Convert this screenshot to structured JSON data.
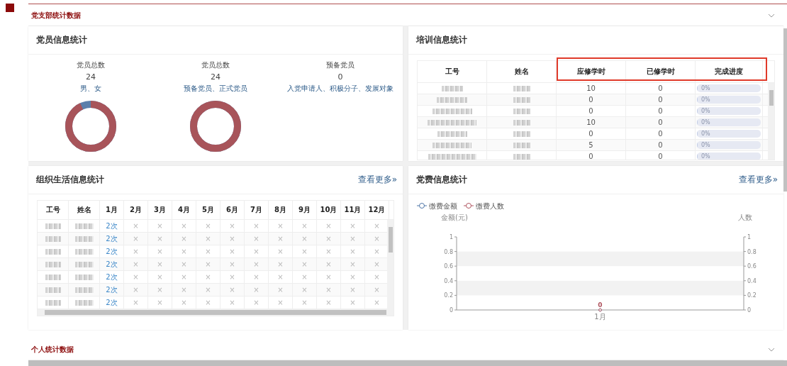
{
  "sections": [
    {
      "title": "党支部统计数据",
      "expanded": true
    },
    {
      "title": "个人统计数据",
      "expanded": false
    }
  ],
  "member_card": {
    "title": "党员信息统计",
    "stats": [
      {
        "label": "党员总数",
        "value": "24",
        "breakdown": "男、女",
        "donut": {
          "level": 0.93
        }
      },
      {
        "label": "党员总数",
        "value": "24",
        "breakdown": "预备党员、正式党员",
        "donut": {
          "level": 1
        }
      },
      {
        "label": "预备党员",
        "value": "0",
        "breakdown": "入党申请人、积极分子、发展对象"
      }
    ]
  },
  "training_card": {
    "title": "培训信息统计",
    "columns": [
      {
        "label": "工号",
        "highlighted": false
      },
      {
        "label": "姓名",
        "highlighted": false
      },
      {
        "label": "应修学时",
        "highlighted": true
      },
      {
        "label": "已修学时",
        "highlighted": true
      },
      {
        "label": "完成进度",
        "highlighted": true
      }
    ],
    "rows": [
      {
        "required": "10",
        "completed": "0",
        "progress": "0%",
        "level": 0
      },
      {
        "required": "0",
        "completed": "0",
        "progress": "0%",
        "level": 0
      },
      {
        "required": "0",
        "completed": "0",
        "progress": "0%",
        "level": 0
      },
      {
        "required": "10",
        "completed": "0",
        "progress": "0%",
        "level": 0
      },
      {
        "required": "0",
        "completed": "0",
        "progress": "0%",
        "level": 0
      },
      {
        "required": "5",
        "completed": "0",
        "progress": "0%",
        "level": 0
      },
      {
        "required": "0",
        "completed": "0",
        "progress": "0%",
        "level": 0
      }
    ]
  },
  "life_card": {
    "title": "组织生活信息统计",
    "more_link": "查看更多»",
    "columns": [
      "工号",
      "姓名",
      "1月",
      "2月",
      "3月",
      "4月",
      "5月",
      "6月",
      "7月",
      "8月",
      "9月",
      "10月",
      "11月",
      "12月"
    ],
    "rows": [
      {
        "months": [
          "2次",
          "×",
          "×",
          "×",
          "×",
          "×",
          "×",
          "×",
          "×",
          "×",
          "×",
          "×"
        ]
      },
      {
        "months": [
          "2次",
          "×",
          "×",
          "×",
          "×",
          "×",
          "×",
          "×",
          "×",
          "×",
          "×",
          "×"
        ]
      },
      {
        "months": [
          "2次",
          "×",
          "×",
          "×",
          "×",
          "×",
          "×",
          "×",
          "×",
          "×",
          "×",
          "×"
        ]
      },
      {
        "months": [
          "2次",
          "×",
          "×",
          "×",
          "×",
          "×",
          "×",
          "×",
          "×",
          "×",
          "×",
          "×"
        ]
      },
      {
        "months": [
          "2次",
          "×",
          "×",
          "×",
          "×",
          "×",
          "×",
          "×",
          "×",
          "×",
          "×",
          "×"
        ]
      },
      {
        "months": [
          "2次",
          "×",
          "×",
          "×",
          "×",
          "×",
          "×",
          "×",
          "×",
          "×",
          "×",
          "×"
        ]
      },
      {
        "months": [
          "2次",
          "×",
          "×",
          "×",
          "×",
          "×",
          "×",
          "×",
          "×",
          "×",
          "×",
          "×"
        ]
      }
    ]
  },
  "fee_card": {
    "title": "党费信息统计",
    "more_link": "查看更多»",
    "chart_data": {
      "type": "line",
      "ylabel": "金额(元)",
      "categories": [
        "1月"
      ],
      "series": [
        {
          "name": "缴费金额",
          "color": "#4f76a8",
          "marker": "circle",
          "values": [
            0
          ]
        },
        {
          "name": "缴费人数",
          "color": "#b05560",
          "marker": "circle",
          "values": [
            0
          ]
        }
      ],
      "legend": "top",
      "ylim": [
        0,
        1
      ],
      "yticks": [
        0,
        0.2,
        0.4,
        0.6,
        0.8,
        1
      ],
      "value_labels": [
        [
          null
        ],
        [
          "0"
        ]
      ]
    },
    "right_axis": {
      "title": "人数",
      "ticks": [
        "1",
        "0.8",
        "0.6",
        "0.4",
        "0.2",
        "0"
      ]
    }
  }
}
